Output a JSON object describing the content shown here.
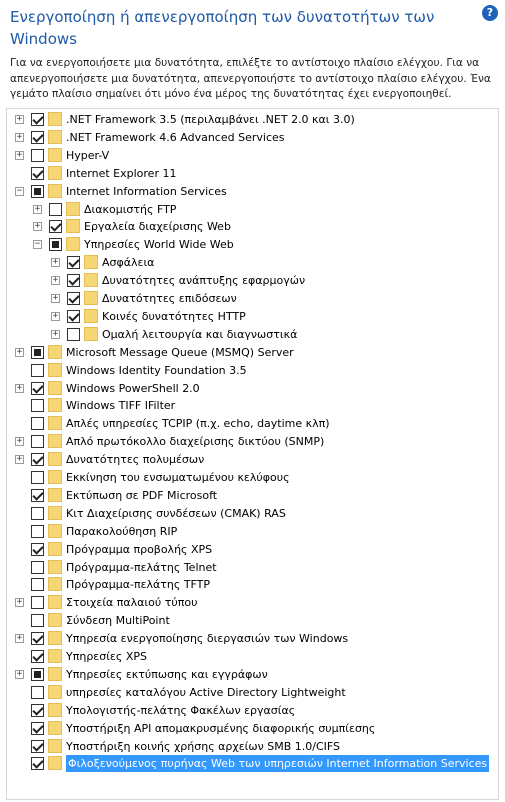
{
  "header": {
    "title": "Ενεργοποίηση ή απενεργοποίηση των δυνατοτήτων των Windows",
    "help_icon": "?",
    "description": "Για να ενεργοποιήσετε μια δυνατότητα, επιλέξτε το αντίστοιχο πλαίσιο ελέγχου. Για να απενεργοποιήσετε μια δυνατότητα, απενεργοποιήστε το αντίστοιχο πλαίσιο ελέγχου. Ένα γεμάτο πλαίσιο σημαίνει ότι μόνο ένα μέρος της δυνατότητας έχει ενεργοποιηθεί."
  },
  "features": [
    {
      "label": ".NET Framework 3.5 (περιλαμβάνει .NET 2.0 και 3.0)",
      "state": "checked",
      "expander": "+",
      "level": 0
    },
    {
      "label": ".NET Framework 4.6 Advanced Services",
      "state": "checked",
      "expander": "+",
      "level": 0
    },
    {
      "label": "Hyper-V",
      "state": "unchecked",
      "expander": "+",
      "level": 0
    },
    {
      "label": "Internet Explorer 11",
      "state": "checked",
      "expander": "",
      "level": 0
    },
    {
      "label": "Internet Information Services",
      "state": "partial",
      "expander": "−",
      "level": 0
    },
    {
      "label": "Διακομιστής FTP",
      "state": "unchecked",
      "expander": "+",
      "level": 1
    },
    {
      "label": "Εργαλεία διαχείρισης Web",
      "state": "checked",
      "expander": "+",
      "level": 1
    },
    {
      "label": "Υπηρεσίες World Wide Web",
      "state": "partial",
      "expander": "−",
      "level": 1
    },
    {
      "label": "Ασφάλεια",
      "state": "checked",
      "expander": "+",
      "level": 2
    },
    {
      "label": "Δυνατότητες ανάπτυξης εφαρμογών",
      "state": "checked",
      "expander": "+",
      "level": 2
    },
    {
      "label": "Δυνατότητες επιδόσεων",
      "state": "checked",
      "expander": "+",
      "level": 2
    },
    {
      "label": "Κοινές δυνατότητες HTTP",
      "state": "checked",
      "expander": "+",
      "level": 2
    },
    {
      "label": "Ομαλή λειτουργία και διαγνωστικά",
      "state": "unchecked",
      "expander": "+",
      "level": 2
    },
    {
      "label": "Microsoft Message Queue (MSMQ) Server",
      "state": "partial",
      "expander": "+",
      "level": 0
    },
    {
      "label": "Windows Identity Foundation 3.5",
      "state": "unchecked",
      "expander": "",
      "level": 0
    },
    {
      "label": "Windows PowerShell 2.0",
      "state": "checked",
      "expander": "+",
      "level": 0
    },
    {
      "label": "Windows TIFF IFilter",
      "state": "unchecked",
      "expander": "",
      "level": 0
    },
    {
      "label": "Απλές υπηρεσίες TCPIP (π.χ. echo, daytime κλπ)",
      "state": "unchecked",
      "expander": "",
      "level": 0
    },
    {
      "label": "Απλό πρωτόκολλο διαχείρισης δικτύου (SNMP)",
      "state": "unchecked",
      "expander": "+",
      "level": 0
    },
    {
      "label": "Δυνατότητες πολυμέσων",
      "state": "checked",
      "expander": "+",
      "level": 0
    },
    {
      "label": "Εκκίνηση του ενσωματωμένου κελύφους",
      "state": "unchecked",
      "expander": "",
      "level": 0
    },
    {
      "label": "Εκτύπωση σε PDF Microsoft",
      "state": "checked",
      "expander": "",
      "level": 0
    },
    {
      "label": "Κιτ Διαχείρισης συνδέσεων (CMAK) RAS",
      "state": "unchecked",
      "expander": "",
      "level": 0
    },
    {
      "label": "Παρακολούθηση RIP",
      "state": "unchecked",
      "expander": "",
      "level": 0
    },
    {
      "label": "Πρόγραμμα προβολής XPS",
      "state": "checked",
      "expander": "",
      "level": 0
    },
    {
      "label": "Πρόγραμμα-πελάτης Telnet",
      "state": "unchecked",
      "expander": "",
      "level": 0
    },
    {
      "label": "Πρόγραμμα-πελάτης TFTP",
      "state": "unchecked",
      "expander": "",
      "level": 0
    },
    {
      "label": "Στοιχεία παλαιού τύπου",
      "state": "unchecked",
      "expander": "+",
      "level": 0
    },
    {
      "label": "Σύνδεση MultiPoint",
      "state": "unchecked",
      "expander": "",
      "level": 0
    },
    {
      "label": "Υπηρεσία ενεργοποίησης διεργασιών των Windows",
      "state": "checked",
      "expander": "+",
      "level": 0
    },
    {
      "label": "Υπηρεσίες XPS",
      "state": "checked",
      "expander": "",
      "level": 0
    },
    {
      "label": "Υπηρεσίες εκτύπωσης και εγγράφων",
      "state": "partial",
      "expander": "+",
      "level": 0
    },
    {
      "label": "υπηρεσίες καταλόγου Active Directory Lightweight",
      "state": "unchecked",
      "expander": "",
      "level": 0
    },
    {
      "label": "Υπολογιστής-πελάτης Φακέλων εργασίας",
      "state": "checked",
      "expander": "",
      "level": 0
    },
    {
      "label": "Υποστήριξη API απομακρυσμένης διαφορικής συμπίεσης",
      "state": "checked",
      "expander": "",
      "level": 0
    },
    {
      "label": "Υποστήριξη κοινής χρήσης αρχείων SMB 1.0/CIFS",
      "state": "checked",
      "expander": "",
      "level": 0
    },
    {
      "label": "Φιλοξενούμενος πυρήνας Web των υπηρεσιών Internet Information Services",
      "state": "checked",
      "expander": "",
      "level": 0,
      "selected": true
    }
  ]
}
